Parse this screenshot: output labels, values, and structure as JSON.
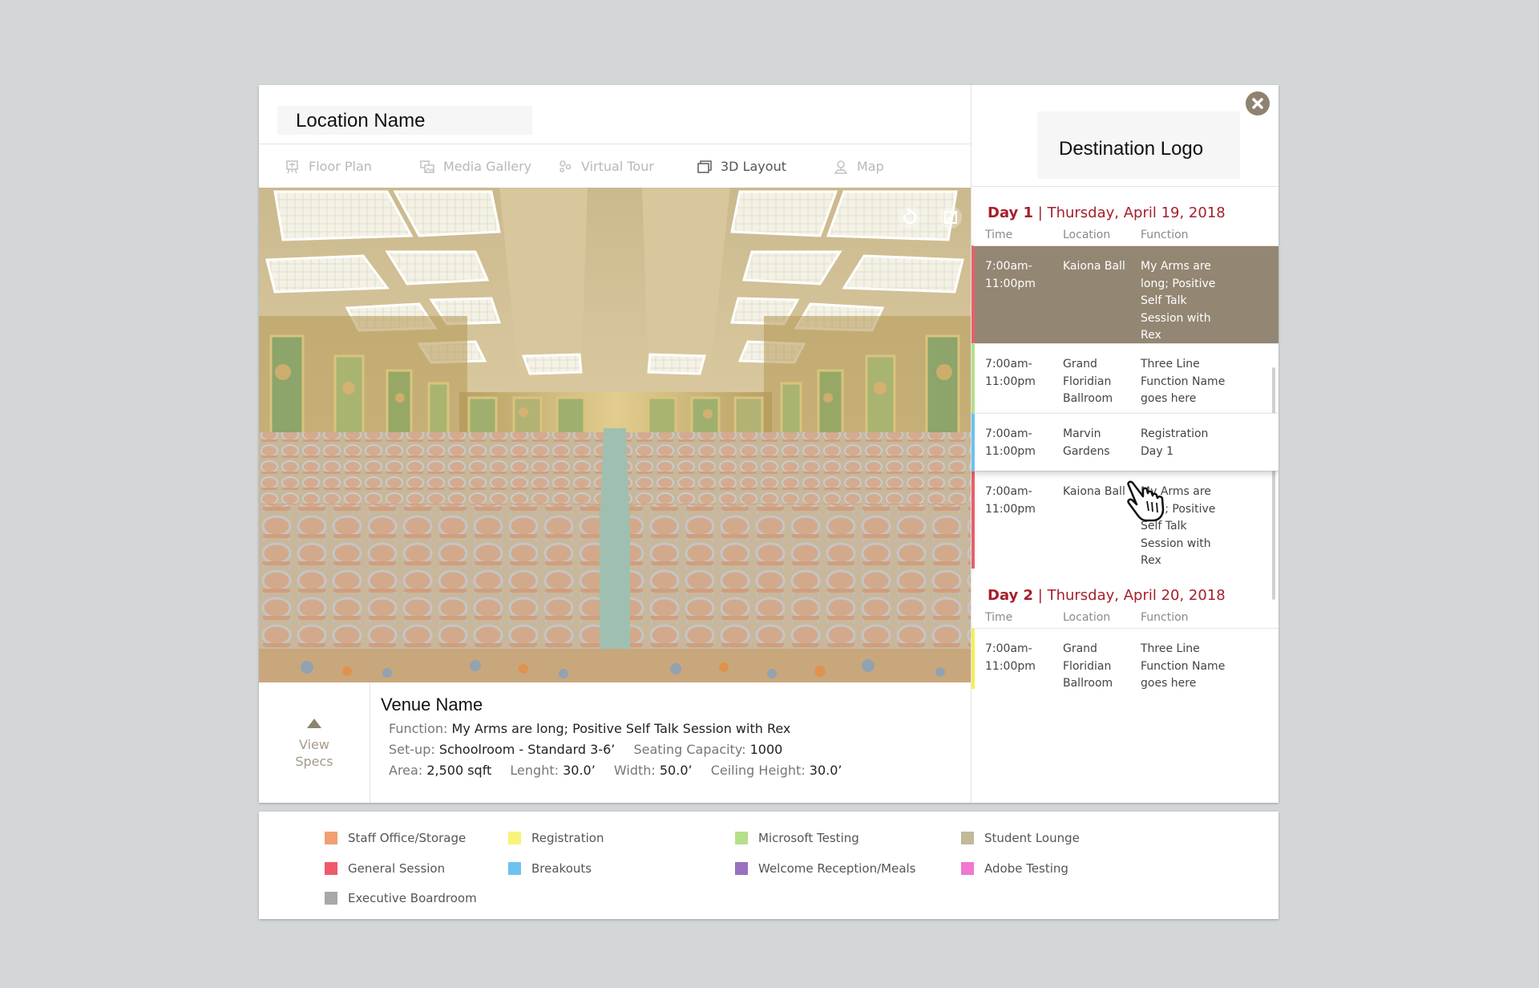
{
  "location": {
    "title": "Location Name"
  },
  "tabs": [
    {
      "label": "Floor Plan",
      "icon": "floor-plan-icon"
    },
    {
      "label": "Media Gallery",
      "icon": "media-gallery-icon"
    },
    {
      "label": "Virtual Tour",
      "icon": "virtual-tour-icon"
    },
    {
      "label": "3D Layout",
      "icon": "3d-layout-icon",
      "active": true
    },
    {
      "label": "Map",
      "icon": "map-pin-icon"
    }
  ],
  "specs": {
    "toggle_label_1": "View",
    "toggle_label_2": "Specs",
    "venue_name": "Venue Name",
    "function_label": "Function:",
    "function_value": "My Arms are long; Positive Self Talk Session with Rex",
    "setup_label": "Set-up:",
    "setup_value": "Schoolroom - Standard 3-6’",
    "capacity_label": "Seating Capacity:",
    "capacity_value": "1000",
    "area_label": "Area:",
    "area_value": "2,500 sqft",
    "length_label": "Lenght:",
    "length_value": "30.0’",
    "width_label": "Width:",
    "width_value": "50.0’",
    "ceiling_label": "Ceiling Height:",
    "ceiling_value": "30.0’"
  },
  "destination": {
    "logo_text": "Destination Logo"
  },
  "schedule": {
    "headers": {
      "time": "Time",
      "location": "Location",
      "function": "Function"
    },
    "days": [
      {
        "day": "Day 1",
        "sep": " | ",
        "date": "Thursday, April 19, 2018",
        "rows": [
          {
            "time": [
              "7:00am-",
              "11:00pm"
            ],
            "location": [
              "Kaiona Ball"
            ],
            "function": [
              "My Arms are",
              "long; Positive",
              "Self Talk",
              "Session with",
              "Rex"
            ],
            "color": "#e8606a",
            "state": "selected"
          },
          {
            "time": [
              "7:00am-",
              "11:00pm"
            ],
            "location": [
              "Grand",
              "Floridian",
              "Ballroom"
            ],
            "function": [
              "Three Line",
              "Function Name",
              "goes here"
            ],
            "color": "#b4e08a",
            "state": "normal"
          },
          {
            "time": [
              "7:00am-",
              "11:00pm"
            ],
            "location": [
              "Marvin",
              "Gardens"
            ],
            "function": [
              "Registration",
              "Day 1"
            ],
            "color": "#6cc3ef",
            "state": "hover"
          },
          {
            "time": [
              "7:00am-",
              "11:00pm"
            ],
            "location": [
              "Kaiona Ball"
            ],
            "function": [
              "My Arms are",
              "long; Positive",
              "Self Talk",
              "Session with",
              "Rex"
            ],
            "color": "#e8606a",
            "state": "normal"
          }
        ]
      },
      {
        "day": "Day 2",
        "sep": " | ",
        "date": "Thursday, April 20, 2018",
        "rows": [
          {
            "time": [
              "7:00am-",
              "11:00pm"
            ],
            "location": [
              "Grand",
              "Floridian",
              "Ballroom"
            ],
            "function": [
              "Three Line",
              "Function Name",
              "goes here"
            ],
            "color": "#f3ef5a",
            "state": "normal"
          }
        ]
      }
    ]
  },
  "legend": [
    {
      "label": "Staff Office/Storage",
      "color": "#f0a070"
    },
    {
      "label": "Registration",
      "color": "#f8f47a"
    },
    {
      "label": "Microsoft Testing",
      "color": "#b4e08a"
    },
    {
      "label": "Student Lounge",
      "color": "#c2b89a"
    },
    {
      "label": "General Session",
      "color": "#ef5a6a"
    },
    {
      "label": "Breakouts",
      "color": "#6cc3ef"
    },
    {
      "label": "Welcome Reception/Meals",
      "color": "#9a70c0"
    },
    {
      "label": "Adobe Testing",
      "color": "#f078d0"
    },
    {
      "label": "Executive Boardroom",
      "color": "#a8a8a8"
    }
  ]
}
